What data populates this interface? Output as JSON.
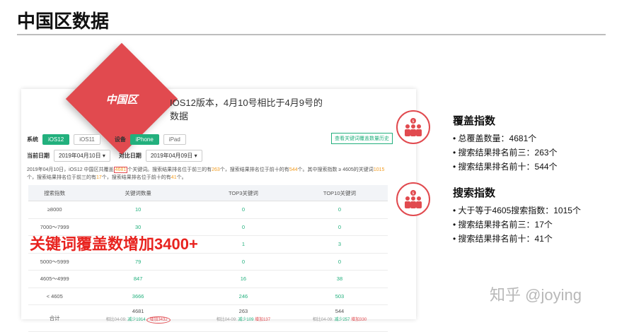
{
  "slide": {
    "title": "中国区数据",
    "watermark": "知乎 @joying"
  },
  "badge": {
    "label": "中国区"
  },
  "intro": "IOS12版本，4月10号相比于4月9号的数据",
  "filters": {
    "system_label": "系统",
    "system_options": [
      "iOS12",
      "iOS11"
    ],
    "device_label": "设备",
    "device_options": [
      "iPhone",
      "iPad"
    ],
    "current_date_label": "当前日期",
    "current_date": "2019年04月10日 ▾",
    "compare_date_label": "对比日期",
    "compare_date": "2019年04月09日 ▾",
    "history_button": "查看关键词覆盖数量历史"
  },
  "summary": {
    "p1": "2019年04月10日，iOS12 中国区共覆盖",
    "total": "4681",
    "p2": "个关键词。搜索结果排名位于前三的有",
    "top3": "263",
    "p3": "个，搜索结果排名位于前十的有",
    "top10": "544",
    "p4": "个。其中搜索指数 ≥ 4605的关键词",
    "hi": "1015",
    "p5": "个，搜索结果排名位于前三的有",
    "hi_top3": "17",
    "p6": "个，搜索结果排名位于前十的有",
    "hi_top10": "41",
    "p7": "个。"
  },
  "table": {
    "headers": [
      "搜索指数",
      "关键词数量",
      "TOP3关键词",
      "TOP10关键词"
    ],
    "rows": [
      [
        "≥8000",
        "10",
        "0",
        "0"
      ],
      [
        "7000～7999",
        "30",
        "0",
        "0"
      ],
      [
        "",
        "",
        "1",
        "3"
      ],
      [
        "5000～5999",
        "79",
        "0",
        "0"
      ],
      [
        "4605～4999",
        "847",
        "16",
        "38"
      ],
      [
        "< 4605",
        "3666",
        "246",
        "503"
      ]
    ],
    "total_label": "合计",
    "totals": [
      "4681",
      "263",
      "544"
    ],
    "compare": [
      {
        "prefix": "相比04-09:",
        "down": "减少1914",
        "up": "增加3432"
      },
      {
        "prefix": "相比04-09:",
        "down": "减少109",
        "up": "增加137"
      },
      {
        "prefix": "相比04-09:",
        "down": "减少257",
        "up": "增加330"
      }
    ]
  },
  "overlay": "关键词覆盖数增加3400+",
  "coverage": {
    "title": "覆盖指数",
    "items": [
      "总覆盖数量：4681个",
      "搜索结果排名前三：263个",
      "搜索结果排名前十：544个"
    ]
  },
  "search": {
    "title": "搜索指数",
    "items": [
      "大于等于4605搜索指数：1015个",
      "搜索结果排名前三：17个",
      "搜索结果排名前十：41个"
    ]
  },
  "colors": {
    "accent_red": "#e14a4f",
    "green": "#22b07d",
    "orange": "#f29b1f"
  },
  "icons": [
    "people-money-icon",
    "people-money-icon"
  ]
}
